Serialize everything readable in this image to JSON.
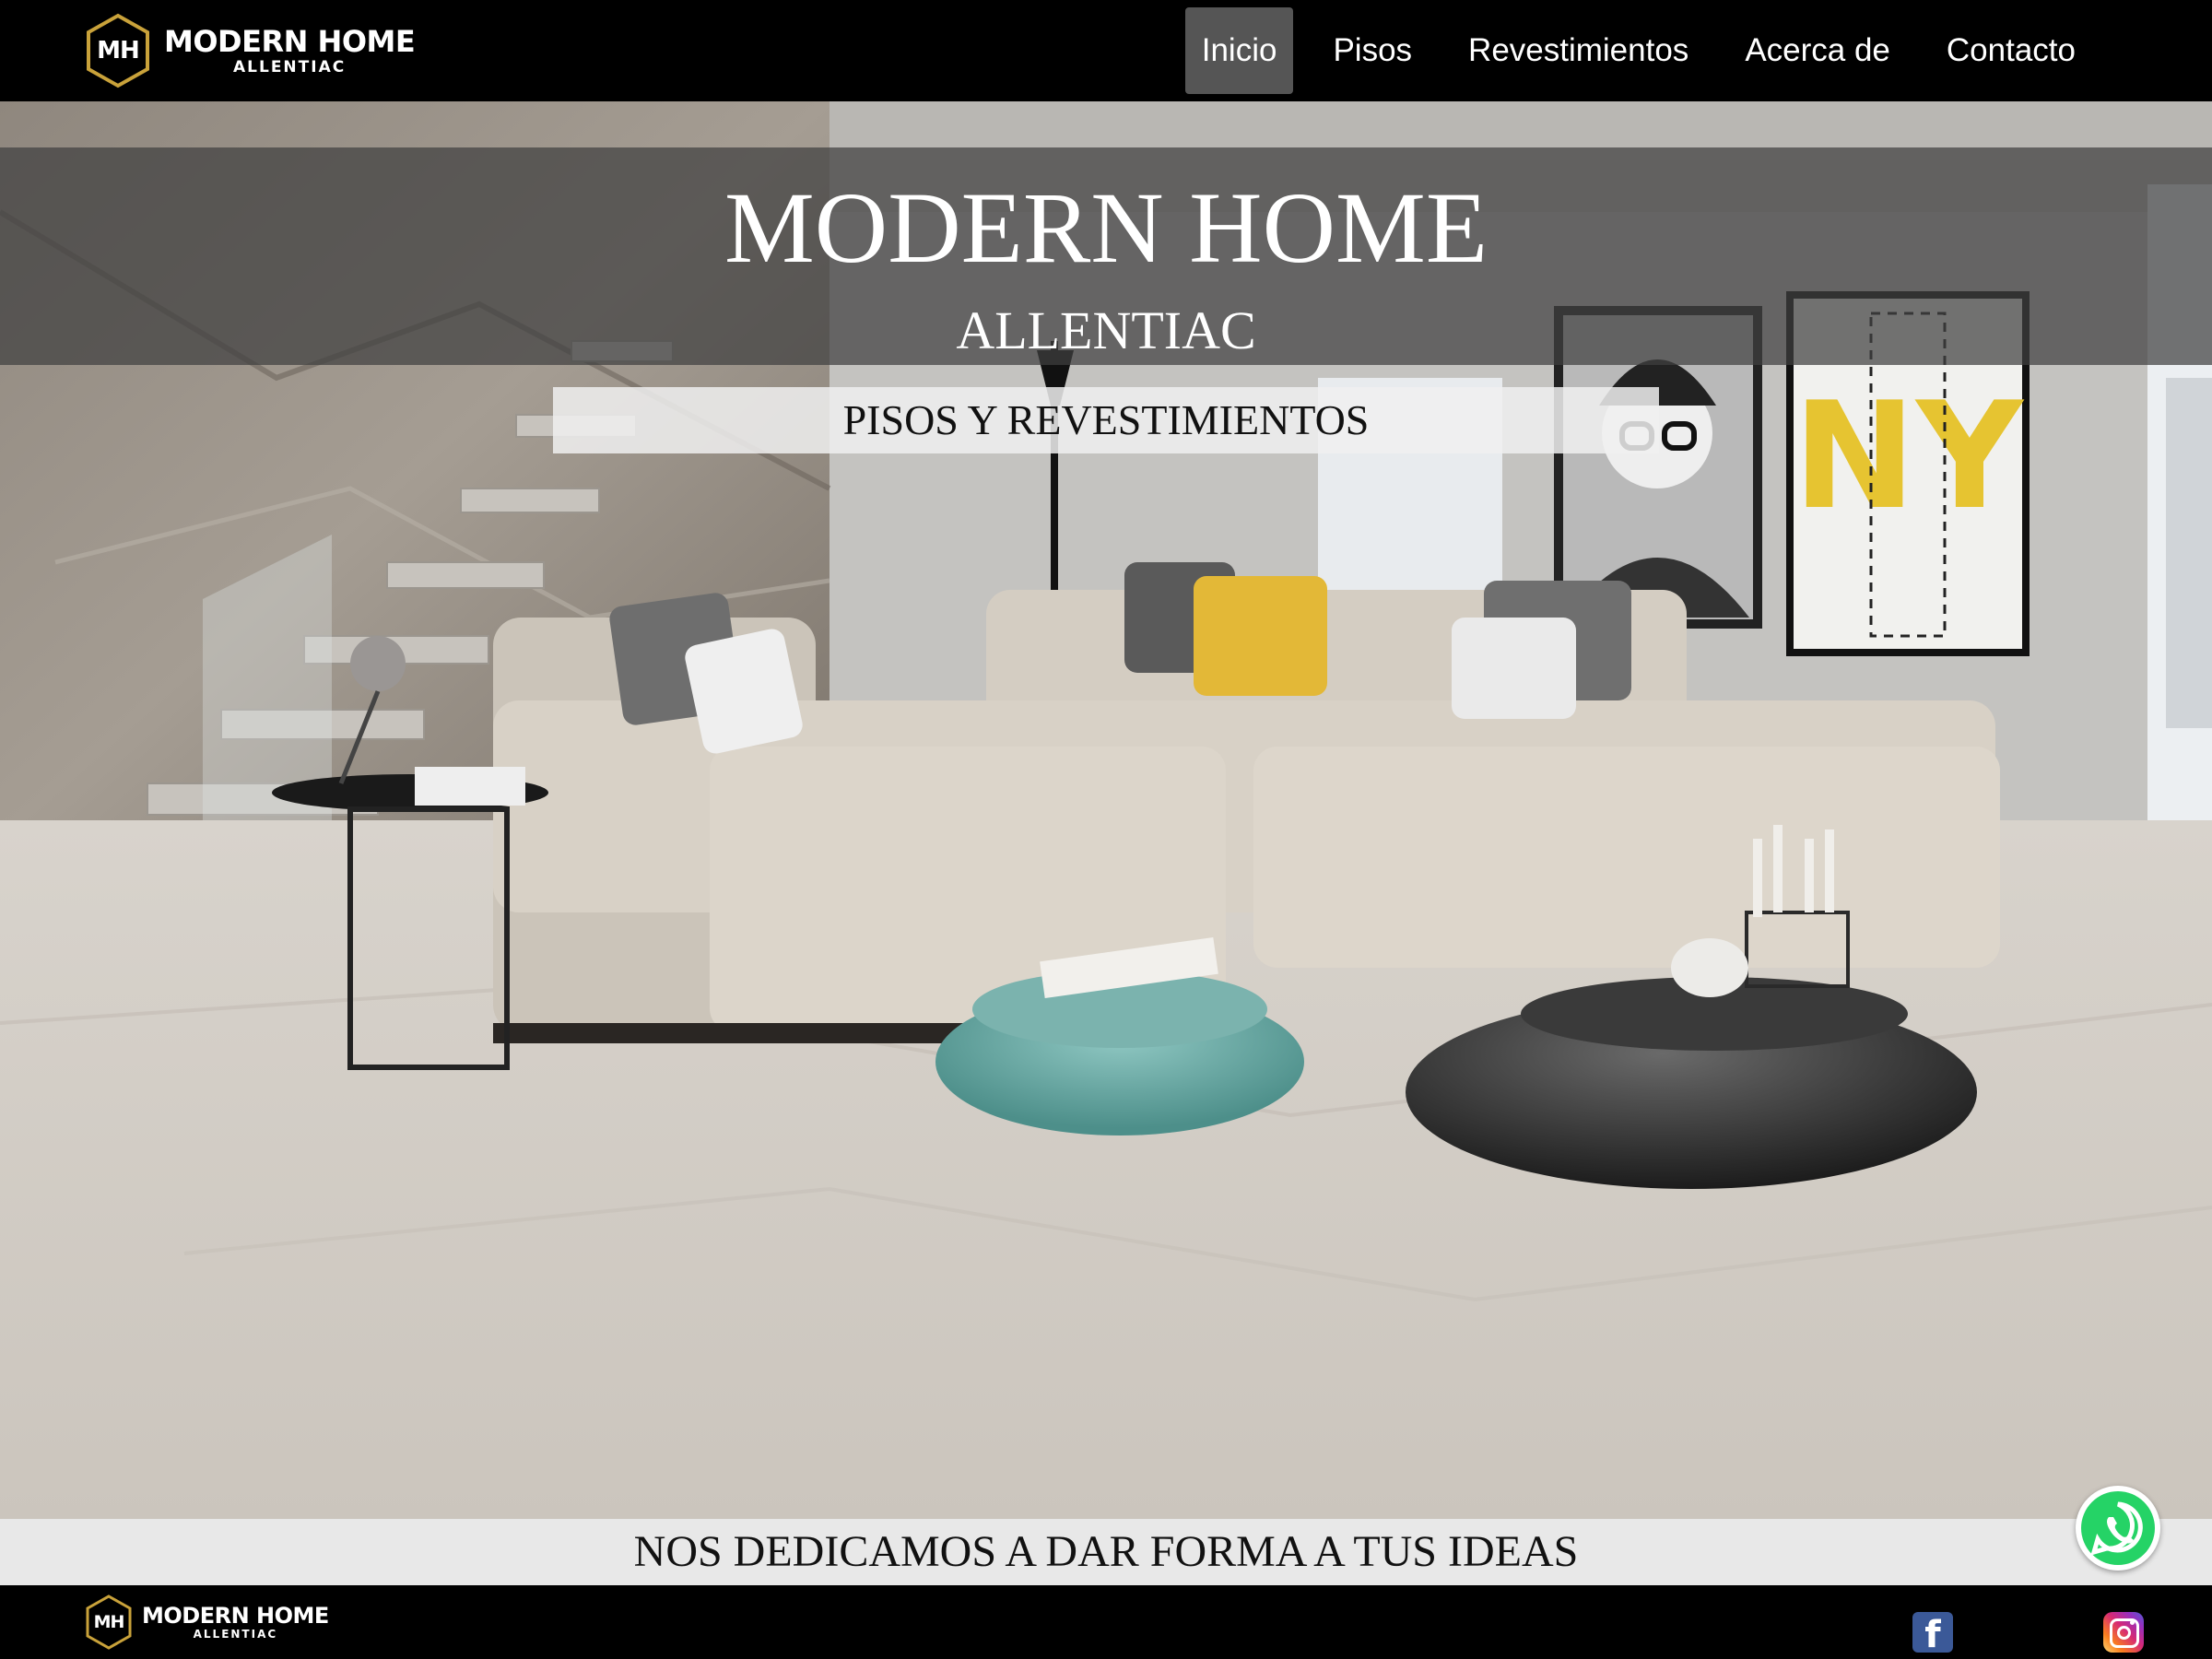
{
  "brand": {
    "monogram": "MH",
    "name": "MODERN HOME",
    "subname": "ALLENTIAC"
  },
  "nav": {
    "items": [
      {
        "label": "Inicio",
        "active": true
      },
      {
        "label": "Pisos",
        "active": false
      },
      {
        "label": "Revestimientos",
        "active": false
      },
      {
        "label": "Acerca de",
        "active": false
      },
      {
        "label": "Contacto",
        "active": false
      }
    ]
  },
  "hero": {
    "title": "MODERN HOME",
    "subtitle": "ALLENTIAC",
    "tag": "PISOS Y REVESTIMIENTOS",
    "poster_text": "NY"
  },
  "tagline": "NOS DEDICAMOS A DAR FORMA A TUS IDEAS",
  "footer": {
    "monogram": "MH",
    "name": "MODERN HOME",
    "subname": "ALLENTIAC",
    "social": [
      {
        "icon": "facebook-icon",
        "glyph": "f"
      },
      {
        "icon": "instagram-icon"
      }
    ]
  },
  "floating": {
    "icon": "whatsapp-icon"
  },
  "colors": {
    "nav_bg": "#000000",
    "nav_active": "#555555",
    "logo_gold": "#c9a23a",
    "whatsapp": "#25d366",
    "facebook": "#3b5998"
  }
}
